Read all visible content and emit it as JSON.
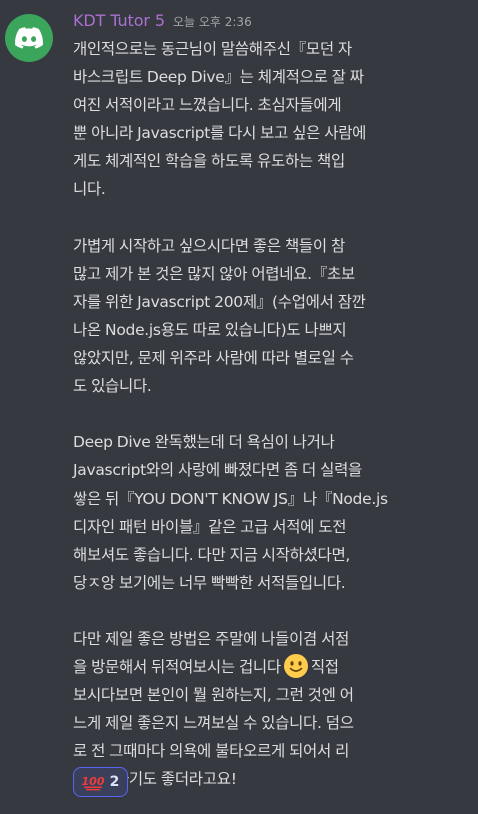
{
  "message": {
    "username": "KDT Tutor 5",
    "timestamp": "오늘 오후 2:36",
    "avatar_icon": "discord-logo-icon",
    "colors": {
      "background": "#36393f",
      "username": "#a970cf",
      "avatar": "#3ba55c",
      "reaction_border": "#5865f2"
    },
    "paragraphs": [
      {
        "lines": [
          "개인적으로는 동근님이 말씀해주신『모던 자",
          "바스크립트 Deep Dive』는 체계적으로 잘 짜",
          "여진 서적이라고 느꼈습니다. 초심자들에게",
          "뿐 아니라 Javascript를 다시 보고 싶은 사람에",
          "게도 체계적인 학습을 하도록 유도하는 책입",
          "니다."
        ]
      },
      {
        "lines": [
          "가볍게 시작하고 싶으시다면 좋은 책들이 참",
          "많고 제가 본 것은 많지 않아 어렵네요.『초보",
          "자를 위한 Javascript 200제』(수업에서 잠깐",
          "나온 Node.js용도 따로 있습니다)도 나쁘지",
          "않았지만, 문제 위주라 사람에 따라 별로일 수",
          "도 있습니다."
        ]
      },
      {
        "lines": [
          "Deep Dive 완독했는데 더 욕심이 나거나",
          "Javascript와의 사랑에 빠졌다면 좀 더 실력을",
          "쌓은 뒤『YOU DON'T KNOW JS』나『Node.js",
          "디자인 패턴 바이블』같은 고급 서적에 도전",
          "해보셔도 좋습니다. 다만 지금 시작하셨다면,",
          "당ㅈ앙 보기에는 너무 빡빡한 서적들입니다."
        ]
      },
      {
        "lines_before_emoji": [
          "다만 제일 좋은 방법은 주말에 나들이겸 서점"
        ],
        "emoji_line_start": "을 방문해서 뒤적여보시는 겁니다",
        "emoji_icon": "slightly-smiling-face-icon",
        "emoji_line_end": "직접",
        "lines_after_emoji": [
          "보시다보면 본인이 뭘 원하는지, 그런 것엔 어",
          "느게 제일 좋은지 느껴보실 수 있습니다. 덤으",
          "로 전 그때마다 의욕에 불타오르게 되어서 리",
          "프레시하기도 좋더라고요!"
        ]
      }
    ],
    "reaction": {
      "emoji_icon": "hundred-points-icon",
      "count": "2"
    }
  }
}
